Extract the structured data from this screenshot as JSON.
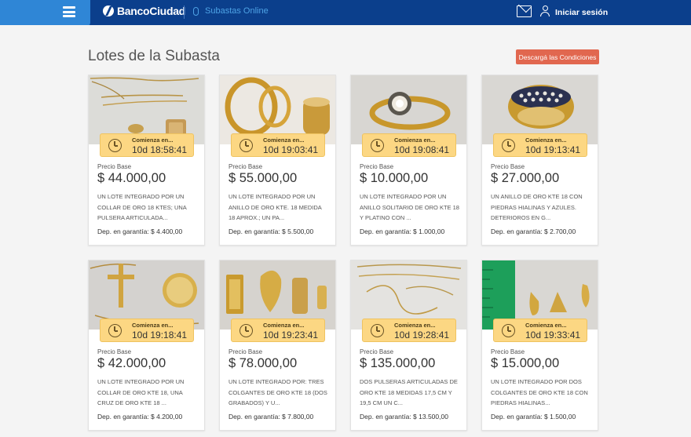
{
  "header": {
    "brand": "BancoCiudad",
    "section": "Subastas Online",
    "login_label": "Iniciar sesión"
  },
  "page": {
    "title": "Lotes de la Subasta",
    "conditions_button": "Descargá las Condiciones"
  },
  "card_labels": {
    "starts": "Comienza en...",
    "base_price": "Precio Base"
  },
  "lots": [
    {
      "countdown": "10d 18:58:41",
      "price": "$ 44.000,00",
      "desc": "UN LOTE INTEGRADO POR UN COLLAR DE ORO 18 KTES; UNA PULSERA ARTICULADA...",
      "deposit": "Dep. en garantía: $ 4.400,00"
    },
    {
      "countdown": "10d 19:03:41",
      "price": "$ 55.000,00",
      "desc": "UN LOTE INTEGRADO POR UN ANILLO DE ORO KTE. 18 MEDIDA 18 APROX.; UN PA...",
      "deposit": "Dep. en garantía: $ 5.500,00"
    },
    {
      "countdown": "10d 19:08:41",
      "price": "$ 10.000,00",
      "desc": "UN LOTE INTEGRADO POR UN ANILLO SOLITARIO DE ORO KTE 18 Y PLATINO CON ...",
      "deposit": "Dep. en garantía: $ 1.000,00"
    },
    {
      "countdown": "10d 19:13:41",
      "price": "$ 27.000,00",
      "desc": "UN ANILLO DE ORO KTE 18 CON PIEDRAS HIALINAS Y AZULES. DETERIOROS EN G...",
      "deposit": "Dep. en garantía: $ 2.700,00"
    },
    {
      "countdown": "10d 19:18:41",
      "price": "$ 42.000,00",
      "desc": "UN LOTE INTEGRADO POR UN COLLAR DE ORO KTE 18, UNA CRUZ DE ORO KTE 18 ...",
      "deposit": "Dep. en garantía: $ 4.200,00"
    },
    {
      "countdown": "10d 19:23:41",
      "price": "$ 78.000,00",
      "desc": "UN LOTE INTEGRADO POR: TRES COLGANTES DE ORO KTE 18 (DOS GRABADOS) Y U...",
      "deposit": "Dep. en garantía: $ 7.800,00"
    },
    {
      "countdown": "10d 19:28:41",
      "price": "$ 135.000,00",
      "desc": "DOS PULSERAS ARTICULADAS DE ORO KTE 18 MEDIDAS 17,5 CM Y 19,5 CM UN C...",
      "deposit": "Dep. en garantía: $ 13.500,00"
    },
    {
      "countdown": "10d 19:33:41",
      "price": "$ 15.000,00",
      "desc": "UN LOTE INTEGRADO POR DOS COLGANTES DE ORO KTE 18 CON PIEDRAS HIALINAS...",
      "deposit": "Dep. en garantía: $ 1.500,00"
    }
  ],
  "colors": {
    "header_bg": "#0b3f8c",
    "header_accent": "#2f86d6",
    "button_bg": "#e1674f",
    "timer_bg": "#fcd783"
  }
}
